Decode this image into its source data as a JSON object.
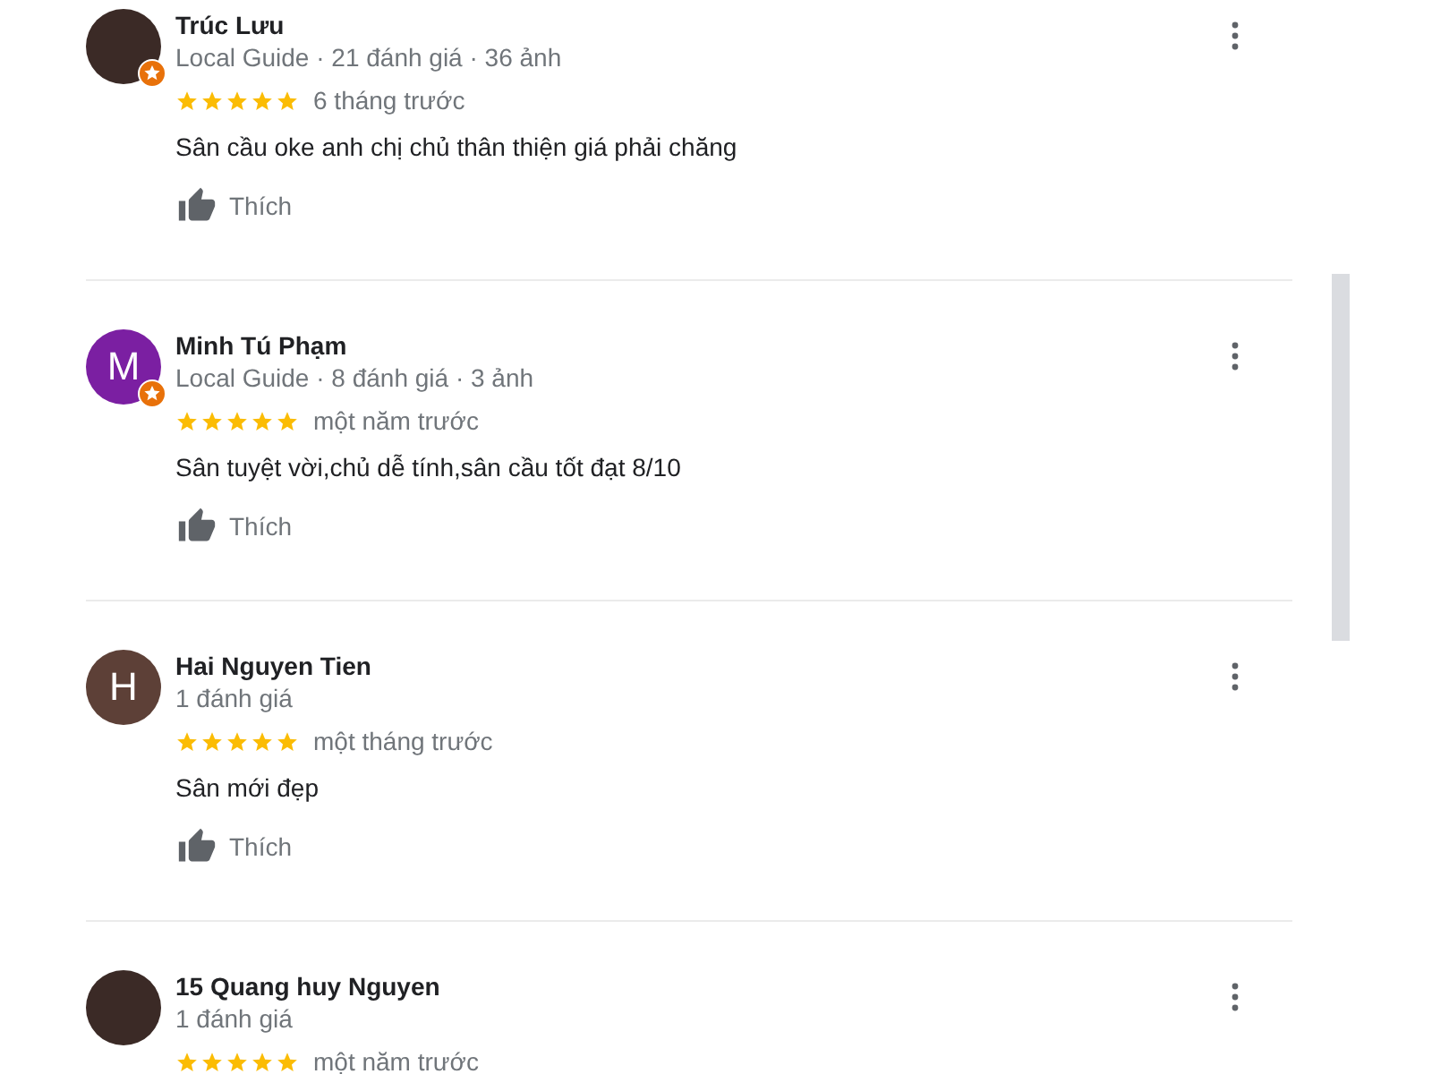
{
  "reviews": [
    {
      "name": "Trúc Lưu",
      "avatar": {
        "kind": "photo"
      },
      "local_guide": true,
      "meta": "Local Guide · 21 đánh giá · 36 ảnh",
      "stars": 5,
      "time": "6 tháng trước",
      "text": "Sân cầu oke anh chị chủ thân thiện giá phải chăng",
      "like": "Thích"
    },
    {
      "name": "Minh Tú Phạm",
      "avatar": {
        "kind": "letter",
        "letter": "M",
        "color": "#7b1fa2"
      },
      "local_guide": true,
      "meta": "Local Guide · 8 đánh giá · 3 ảnh",
      "stars": 5,
      "time": "một năm trước",
      "text": "Sân tuyệt vời,chủ dễ tính,sân cầu tốt đạt 8/10",
      "like": "Thích"
    },
    {
      "name": "Hai Nguyen Tien",
      "avatar": {
        "kind": "letter",
        "letter": "H",
        "color": "#5d4037"
      },
      "local_guide": false,
      "meta": "1 đánh giá",
      "stars": 5,
      "time": "một tháng trước",
      "text": "Sân mới đẹp",
      "like": "Thích"
    },
    {
      "name": "15 Quang huy Nguyen",
      "avatar": {
        "kind": "photo"
      },
      "local_guide": false,
      "meta": "1 đánh giá",
      "stars": 5,
      "time": "một năm trước"
    }
  ]
}
